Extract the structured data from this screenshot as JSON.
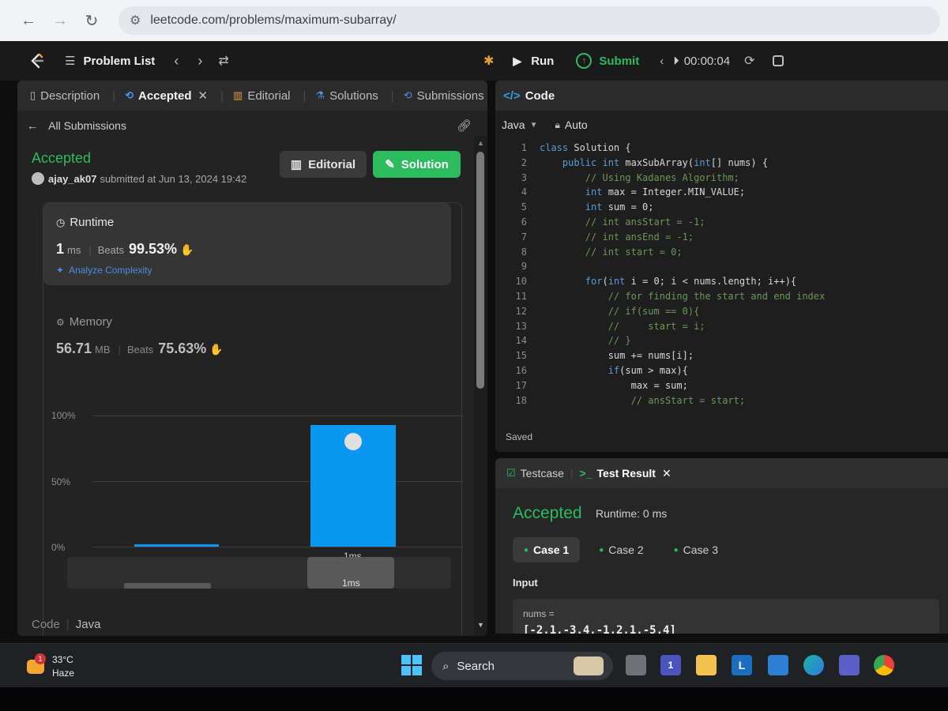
{
  "browser": {
    "url": "leetcode.com/problems/maximum-subarray/"
  },
  "header": {
    "problem_list": "Problem List",
    "run": "Run",
    "submit": "Submit",
    "timer": "00:00:04"
  },
  "left_tabs": [
    {
      "label": "Description"
    },
    {
      "label": "Accepted"
    },
    {
      "label": "Editorial"
    },
    {
      "label": "Solutions"
    },
    {
      "label": "Submissions"
    }
  ],
  "submission": {
    "back_link": "All Submissions",
    "status": "Accepted",
    "user": "ajay_ak07",
    "submitted_text": "submitted at Jun 13, 2024 19:42",
    "editorial_btn": "Editorial",
    "solution_btn": "Solution",
    "runtime_label": "Runtime",
    "runtime_value": "1",
    "runtime_unit": "ms",
    "beats_label": "Beats",
    "runtime_beats": "99.53%",
    "analyze": "Analyze Complexity",
    "memory_label": "Memory",
    "memory_value": "56.71",
    "memory_unit": "MB",
    "memory_beats": "75.63%",
    "code_label": "Code",
    "code_lang": "Java"
  },
  "chart_data": {
    "type": "bar",
    "y_ticks": [
      "100%",
      "50%",
      "0%"
    ],
    "ylim": [
      0,
      100
    ],
    "bars": [
      {
        "value": 2,
        "label": ""
      },
      {
        "value": 93,
        "label": "1ms"
      }
    ],
    "navigator_label": "1ms"
  },
  "code_panel": {
    "title": "Code",
    "language": "Java",
    "mode": "Auto",
    "saved": "Saved",
    "lines": [
      {
        "n": "1",
        "text": "class Solution {"
      },
      {
        "n": "2",
        "text": "    public int maxSubArray(int[] nums) {"
      },
      {
        "n": "3",
        "text": "        // Using Kadanes Algorithm;"
      },
      {
        "n": "4",
        "text": "        int max = Integer.MIN_VALUE;"
      },
      {
        "n": "5",
        "text": "        int sum = 0;"
      },
      {
        "n": "6",
        "text": "        // int ansStart = -1;"
      },
      {
        "n": "7",
        "text": "        // int ansEnd = -1;"
      },
      {
        "n": "8",
        "text": "        // int start = 0;"
      },
      {
        "n": "9",
        "text": ""
      },
      {
        "n": "10",
        "text": "        for(int i = 0; i < nums.length; i++){"
      },
      {
        "n": "11",
        "text": "            // for finding the start and end index"
      },
      {
        "n": "12",
        "text": "            // if(sum == 0){"
      },
      {
        "n": "13",
        "text": "            //     start = i;"
      },
      {
        "n": "14",
        "text": "            // }"
      },
      {
        "n": "15",
        "text": "            sum += nums[i];"
      },
      {
        "n": "16",
        "text": "            if(sum > max){"
      },
      {
        "n": "17",
        "text": "                max = sum;"
      },
      {
        "n": "18",
        "text": "                // ansStart = start;"
      }
    ]
  },
  "test_panel": {
    "tab_testcase": "Testcase",
    "tab_result": "Test Result",
    "status": "Accepted",
    "runtime": "Runtime: 0 ms",
    "cases": [
      "Case 1",
      "Case 2",
      "Case 3"
    ],
    "input_label": "Input",
    "input_name": "nums =",
    "input_value": "[-2,1,-3,4,-1,2,1,-5,4]"
  },
  "taskbar": {
    "temperature": "33°C",
    "weather": "Haze",
    "weather_badge": "1",
    "search": "Search",
    "teams_badge": "1",
    "letter_app": "L"
  },
  "colors": {
    "accent_green": "#2cbb5d",
    "bar_blue": "#0a97f0",
    "link_blue": "#4a90e2"
  }
}
